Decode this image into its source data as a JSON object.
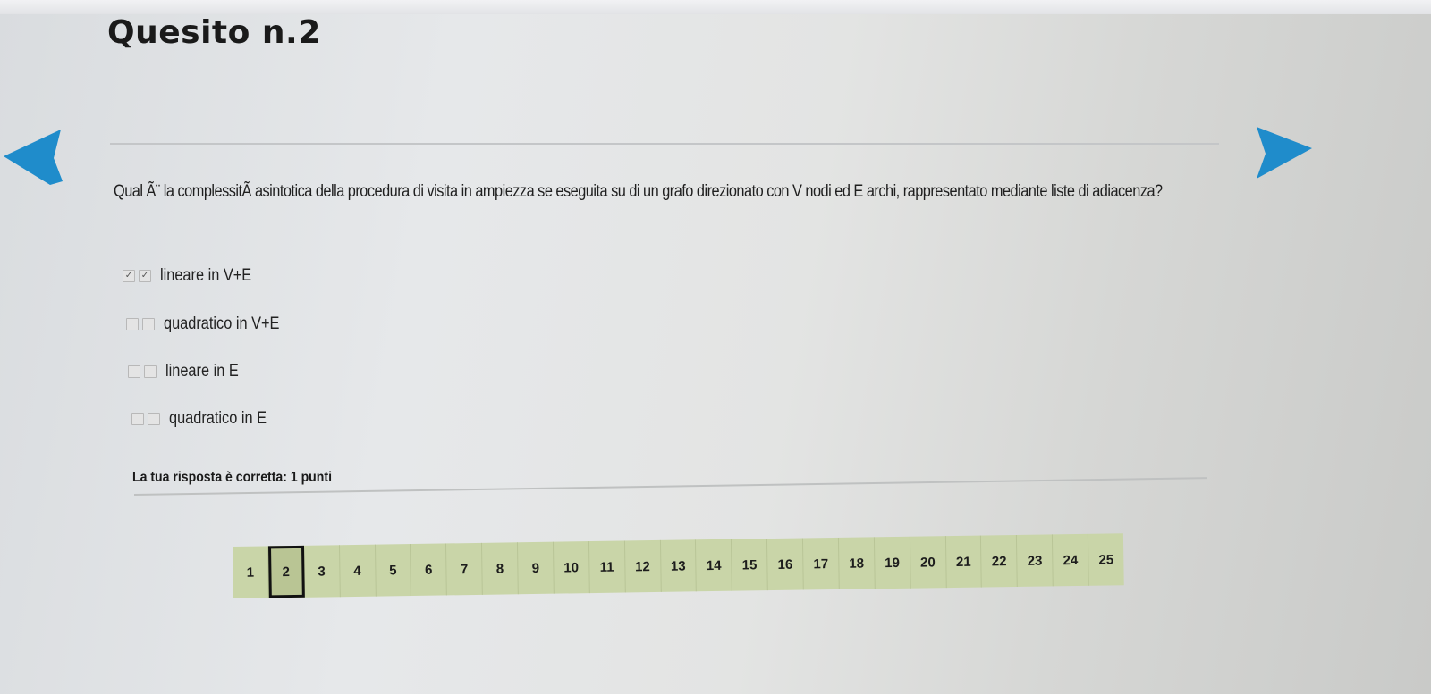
{
  "title": "Quesito n.2",
  "question": {
    "text": "Qual Ã¨ la complessitÃ  asintotica della procedura di visita in ampiezza se eseguita su di un grafo direzionato con V nodi ed E archi, rappresentato mediante liste di adiacenza?"
  },
  "options": [
    {
      "label": "lineare in V+E",
      "selected": true,
      "check_mark": "✓"
    },
    {
      "label": "quadratico in V+E",
      "selected": false
    },
    {
      "label": "lineare in E",
      "selected": false
    },
    {
      "label": "quadratico in E",
      "selected": false
    }
  ],
  "feedback": "La tua risposta è corretta: 1 punti",
  "pager": {
    "current": "2",
    "pages": [
      "1",
      "2",
      "3",
      "4",
      "5",
      "6",
      "7",
      "8",
      "9",
      "10",
      "11",
      "12",
      "13",
      "14",
      "15",
      "16",
      "17",
      "18",
      "19",
      "20",
      "21",
      "22",
      "23",
      "24",
      "25"
    ]
  },
  "colors": {
    "arrow": "#1f8ccb",
    "pager_bg": "#c9d5a8",
    "page_current_border": "#111111"
  },
  "icons": {
    "prev": "arrow-left-icon",
    "next": "arrow-right-icon"
  }
}
